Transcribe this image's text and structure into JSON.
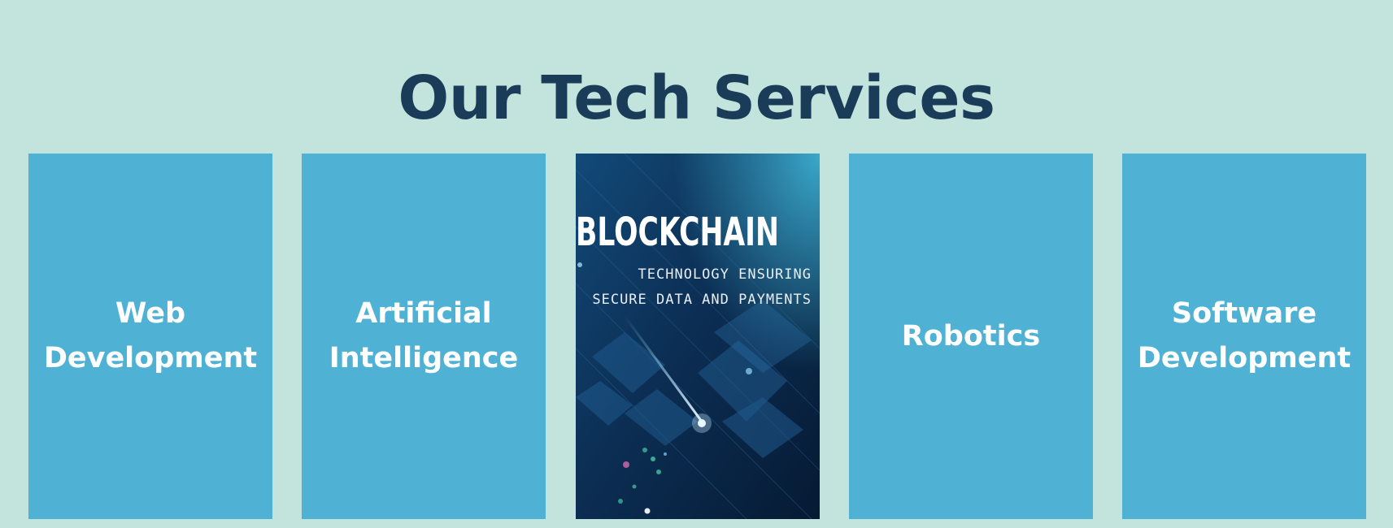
{
  "section": {
    "title": "Our Tech Services"
  },
  "services": [
    {
      "label": "Web Development"
    },
    {
      "label": "Artificial Intelligence"
    },
    {
      "label": "Blockchain",
      "image_text": {
        "headline": "BLOCKCHAIN",
        "line1": "TECHNOLOGY ENSURING",
        "line2": "SECURE DATA AND PAYMENTS"
      }
    },
    {
      "label": "Robotics"
    },
    {
      "label": "Software Development"
    }
  ],
  "colors": {
    "background": "#c2e4dd",
    "title": "#1b3c59",
    "card": "#4fb2d5",
    "card_text": "#ffffff"
  }
}
